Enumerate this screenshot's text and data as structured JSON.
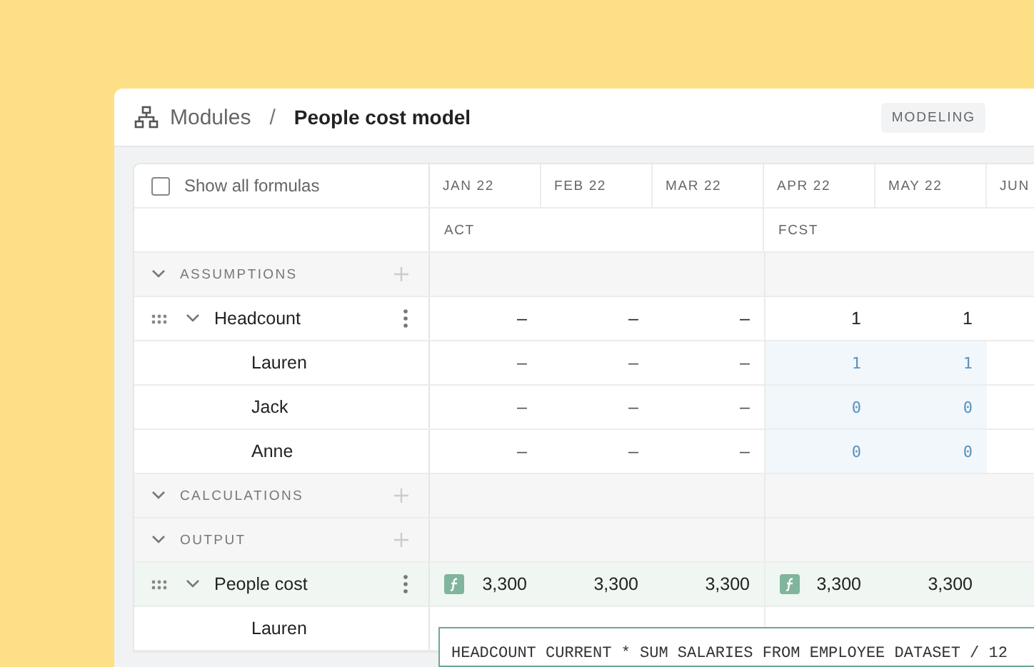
{
  "header": {
    "breadcrumb": [
      {
        "label": "Modules",
        "current": false
      },
      {
        "label": "People cost model",
        "current": true
      }
    ],
    "separator": "/",
    "badge": "MODELING"
  },
  "table": {
    "show_all_formulas": {
      "label": "Show all formulas",
      "checked": false
    },
    "periods": [
      {
        "label": "ACT",
        "columns": [
          {
            "label": "JAN 22"
          },
          {
            "label": "FEB 22"
          },
          {
            "label": "MAR 22"
          }
        ]
      },
      {
        "label": "FCST",
        "columns": [
          {
            "label": "APR 22"
          },
          {
            "label": "MAY 22"
          },
          {
            "label": "JUN"
          }
        ]
      }
    ],
    "sections": [
      {
        "label": "ASSUMPTIONS",
        "expanded": true,
        "children": [
          {
            "name": "Headcount",
            "expanded": true,
            "selected": false,
            "cells": [
              {
                "value": "–",
                "input": false,
                "formula": false
              },
              {
                "value": "–",
                "input": false,
                "formula": false
              },
              {
                "value": "–",
                "input": false,
                "formula": false
              },
              {
                "value": "1",
                "input": false,
                "formula": false
              },
              {
                "value": "1",
                "input": false,
                "formula": false
              }
            ],
            "children": [
              {
                "name": "Lauren",
                "cells": [
                  {
                    "value": "–",
                    "input": false,
                    "formula": false
                  },
                  {
                    "value": "–",
                    "input": false,
                    "formula": false
                  },
                  {
                    "value": "–",
                    "input": false,
                    "formula": false
                  },
                  {
                    "value": "1",
                    "input": true,
                    "formula": false
                  },
                  {
                    "value": "1",
                    "input": true,
                    "formula": false
                  }
                ]
              },
              {
                "name": "Jack",
                "cells": [
                  {
                    "value": "–",
                    "input": false,
                    "formula": false
                  },
                  {
                    "value": "–",
                    "input": false,
                    "formula": false
                  },
                  {
                    "value": "–",
                    "input": false,
                    "formula": false
                  },
                  {
                    "value": "0",
                    "input": true,
                    "formula": false
                  },
                  {
                    "value": "0",
                    "input": true,
                    "formula": false
                  }
                ]
              },
              {
                "name": "Anne",
                "cells": [
                  {
                    "value": "–",
                    "input": false,
                    "formula": false
                  },
                  {
                    "value": "–",
                    "input": false,
                    "formula": false
                  },
                  {
                    "value": "–",
                    "input": false,
                    "formula": false
                  },
                  {
                    "value": "0",
                    "input": true,
                    "formula": false
                  },
                  {
                    "value": "0",
                    "input": true,
                    "formula": false
                  }
                ]
              }
            ]
          }
        ]
      },
      {
        "label": "CALCULATIONS",
        "expanded": true
      },
      {
        "label": "OUTPUT",
        "expanded": true,
        "children": [
          {
            "name": "People cost",
            "expanded": true,
            "selected": true,
            "cells": [
              {
                "value": "3,300",
                "input": false,
                "formula": true
              },
              {
                "value": "3,300",
                "input": false,
                "formula": false
              },
              {
                "value": "3,300",
                "input": false,
                "formula": false
              },
              {
                "value": "3,300",
                "input": false,
                "formula": true
              },
              {
                "value": "3,300",
                "input": false,
                "formula": false
              }
            ],
            "children": [
              {
                "name": "Lauren"
              }
            ]
          }
        ]
      }
    ],
    "formula_popup": {
      "text": "HEADCOUNT CURRENT * SUM SALARIES FROM EMPLOYEE DATASET / 12"
    }
  }
}
